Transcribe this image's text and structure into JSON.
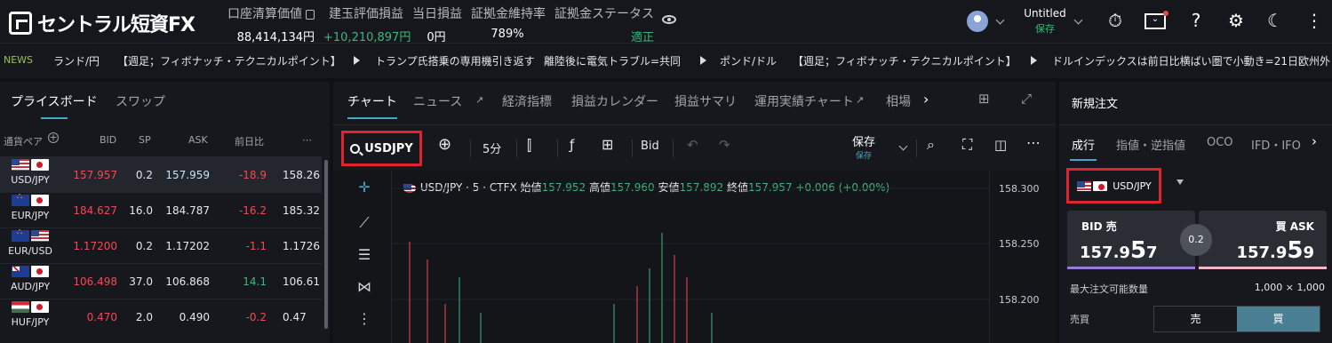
{
  "header": {
    "brand": "セントラル短資FX",
    "account": [
      {
        "label": "口座清算価値",
        "value": "88,414,134円"
      },
      {
        "label": "建玉評価損益",
        "value": "+10,210,897円"
      },
      {
        "label": "当日損益",
        "value": "0円"
      },
      {
        "label": "証拠金維持率",
        "value": "789%"
      },
      {
        "label": "証拠金ステータス",
        "value": "適正"
      }
    ],
    "layout_name": "Untitled",
    "layout_status": "保存"
  },
  "news": {
    "tag": "NEWS",
    "items": [
      "ランド/円",
      "【週足；フィボナッチ・テクニカルポイント】",
      "トランプ氏搭乗の専用機引き返す",
      "離陸後に電気トラブル=共同",
      "ポンド/ドル",
      "【週足；フィボナッチ・テクニカルポイント】",
      "ドルインデックスは前日比横ばい圏で小動き=21日欧州外"
    ]
  },
  "priceboard": {
    "tabs": [
      "プライスボード",
      "スワップ"
    ],
    "columns": {
      "pair": "通貨ペア",
      "bid": "BID",
      "sp": "SP",
      "ask": "ASK",
      "change": "前日比",
      "more": "⋯"
    },
    "rows": [
      {
        "pair": "USD/JPY",
        "bid": "157.957",
        "sp": "0.2",
        "ask": "157.959",
        "change": "-18.9",
        "last": "158.26"
      },
      {
        "pair": "EUR/JPY",
        "bid": "184.627",
        "sp": "16.0",
        "ask": "184.787",
        "change": "-16.2",
        "last": "185.32"
      },
      {
        "pair": "EUR/USD",
        "bid": "1.17200",
        "sp": "0.2",
        "ask": "1.17202",
        "change": "-1.1",
        "last": "1.1726"
      },
      {
        "pair": "AUD/JPY",
        "bid": "106.498",
        "sp": "37.0",
        "ask": "106.868",
        "change": "14.1",
        "last": "106.61"
      },
      {
        "pair": "HUF/JPY",
        "bid": "0.470",
        "sp": "2.0",
        "ask": "0.490",
        "change": "-0.2",
        "last": "0.47"
      }
    ]
  },
  "chart_panel": {
    "tabs": [
      "チャート",
      "ニュース",
      "経済指標",
      "損益カレンダー",
      "損益サマリ",
      "運用実績チャート",
      "相場"
    ],
    "symbol": "USDJPY",
    "interval": "5分",
    "price_type": "Bid",
    "save_label": "保存",
    "save_sub": "保存",
    "title": "USD/JPY · 5 · CTFX",
    "ohlc": {
      "open_label": "始値",
      "open": "157.952",
      "high_label": "高値",
      "high": "157.960",
      "low_label": "安値",
      "low": "157.892",
      "close_label": "終値",
      "close": "157.957",
      "change": "+0.006 (+0.00%)"
    },
    "y_ticks": [
      "158.300",
      "158.250",
      "158.200"
    ]
  },
  "order": {
    "title": "新規注文",
    "tabs": [
      "成行",
      "指値・逆指値",
      "OCO",
      "IFD・IFO"
    ],
    "pair": "USD/JPY",
    "bid_label": "BID 売",
    "bid_main": "157.9",
    "bid_big": "5",
    "bid_small": "7",
    "ask_label": "買 ASK",
    "ask_main": "157.9",
    "ask_big": "5",
    "ask_small": "9",
    "spread": "0.2",
    "max_qty_label": "最大注文可能数量",
    "max_qty_value": "1,000 × 1,000",
    "side_label": "売買",
    "sell": "売",
    "buy": "買"
  },
  "colors": {
    "accent": "#3fa9c9",
    "up": "#3fb67c",
    "down": "#ef4b55",
    "highlight": "#e0232e"
  }
}
